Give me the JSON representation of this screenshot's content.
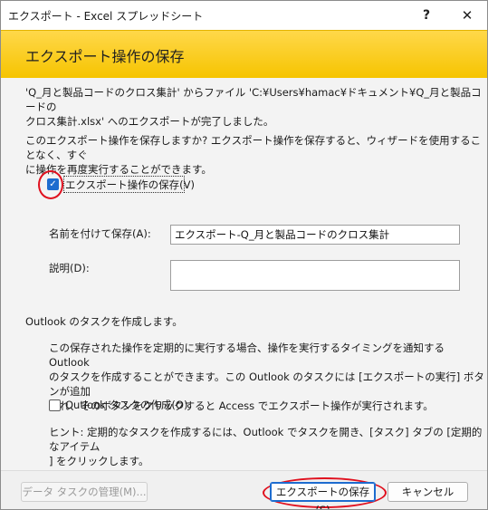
{
  "window": {
    "title": "エクスポート - Excel スプレッドシート",
    "help": "?",
    "close": "✕"
  },
  "banner": {
    "title": "エクスポート操作の保存"
  },
  "summary": {
    "line1": "'Q_月と製品コードのクロス集計' からファイル 'C:¥Users¥hamac¥ドキュメント¥Q_月と製品コードの",
    "line2": "クロス集計.xlsx' へのエクスポートが完了しました。"
  },
  "question": {
    "line1": "このエクスポート操作を保存しますか? エクスポート操作を保存すると、ウィザードを使用することなく、すぐ",
    "line2": "に操作を再度実行することができます。"
  },
  "save_export": {
    "label": "エクスポート操作の保存(V)",
    "checked": true,
    "check_glyph": "✓"
  },
  "name_field": {
    "label": "名前を付けて保存(A):",
    "value": "エクスポート-Q_月と製品コードのクロス集計"
  },
  "description_field": {
    "label": "説明(D):",
    "value": ""
  },
  "outlook": {
    "heading": "Outlook のタスクを作成します。",
    "body1": "この保存された操作を定期的に実行する場合、操作を実行するタイミングを通知する Outlook",
    "body2": "のタスクを作成することができます。この Outlook のタスクには [エクスポートの実行] ボタンが追加",
    "body3": "され、そのボタンをクリックすると Access でエクスポート操作が実行されます。",
    "checkbox_label": "Outlook タスクの作成(O)",
    "checked": false,
    "hint1": "ヒント: 定期的なタスクを作成するには、Outlook でタスクを開き、[タスク] タブの [定期的なアイテム",
    "hint2": "] をクリックします。"
  },
  "footer": {
    "manage_label": "データ タスクの管理(M)...",
    "save_label": "エクスポートの保存(S)",
    "cancel_label": "キャンセル"
  }
}
